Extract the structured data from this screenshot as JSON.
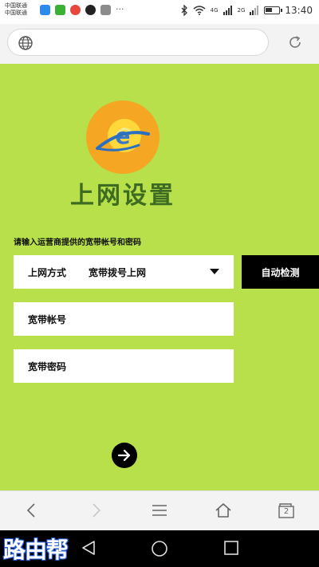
{
  "status_bar": {
    "carrier_line1": "中国联通",
    "carrier_line2": "中国联通",
    "net1": "4G",
    "net2": "2G",
    "time": "13:40",
    "battery_level": 0.5,
    "more_label": "···"
  },
  "address_bar": {
    "url": "",
    "globe_icon": "globe-icon",
    "reload_icon": "reload-icon"
  },
  "page": {
    "title": "上网设置",
    "hint": "请输入运营商提供的宽带帐号和密码",
    "connection_label": "上网方式",
    "connection_value": "宽带拨号上网",
    "auto_detect_label": "自动检测",
    "username_placeholder": "宽带帐号",
    "password_placeholder": "宽带密码",
    "colors": {
      "background": "#b7e04a",
      "title": "#3d6b22",
      "button": "#000000"
    }
  },
  "browser_bar": {
    "icons": [
      "back-icon",
      "forward-icon",
      "menu-icon",
      "home-icon",
      "tabs-icon"
    ],
    "tabs_count": "2"
  },
  "android_nav": {
    "watermark": "路由帮",
    "icons": [
      "nav-back-icon",
      "nav-home-icon",
      "nav-recent-icon"
    ]
  }
}
